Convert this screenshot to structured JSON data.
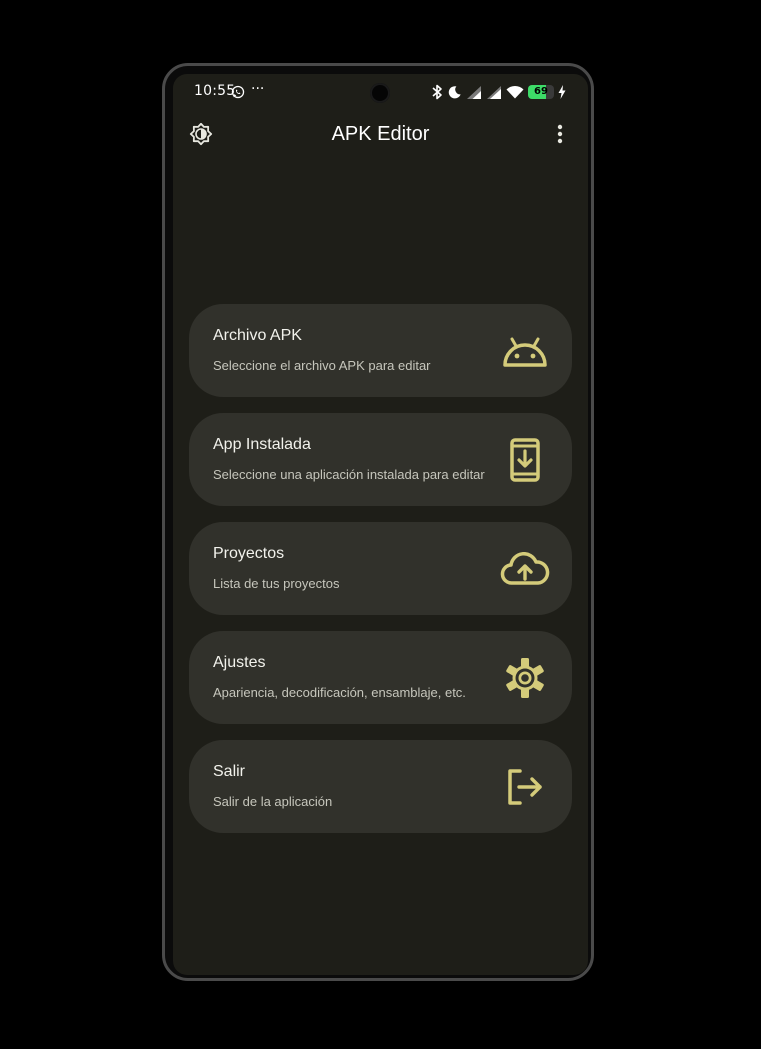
{
  "status_bar": {
    "time": "10:55",
    "more": "···",
    "battery_level": 69,
    "battery_text": "69",
    "icons": [
      "whatsapp-icon",
      "bluetooth-icon",
      "moon-icon",
      "signal-icon",
      "signal-icon",
      "wifi-icon",
      "battery-icon",
      "charging-icon"
    ]
  },
  "app_bar": {
    "title": "APK Editor",
    "left_icon": "theme-brightness-icon",
    "right_icon": "more-vert-icon"
  },
  "colors": {
    "background": "#1e1e18",
    "card": "#31312b",
    "accent": "#d4cb7a",
    "title_text": "#f2f2ec",
    "subtitle_text": "#c6c6bc"
  },
  "menu": {
    "items": [
      {
        "title": "Archivo APK",
        "subtitle": "Seleccione el archivo APK para editar",
        "icon": "android-icon"
      },
      {
        "title": "App Instalada",
        "subtitle": "Seleccione una aplicación instalada para editar",
        "icon": "phone-download-icon"
      },
      {
        "title": "Proyectos",
        "subtitle": "Lista de tus proyectos",
        "icon": "cloud-upload-icon"
      },
      {
        "title": "Ajustes",
        "subtitle": "Apariencia, decodificación, ensamblaje, etc.",
        "icon": "gear-icon"
      },
      {
        "title": "Salir",
        "subtitle": "Salir de la aplicación",
        "icon": "logout-icon"
      }
    ]
  }
}
